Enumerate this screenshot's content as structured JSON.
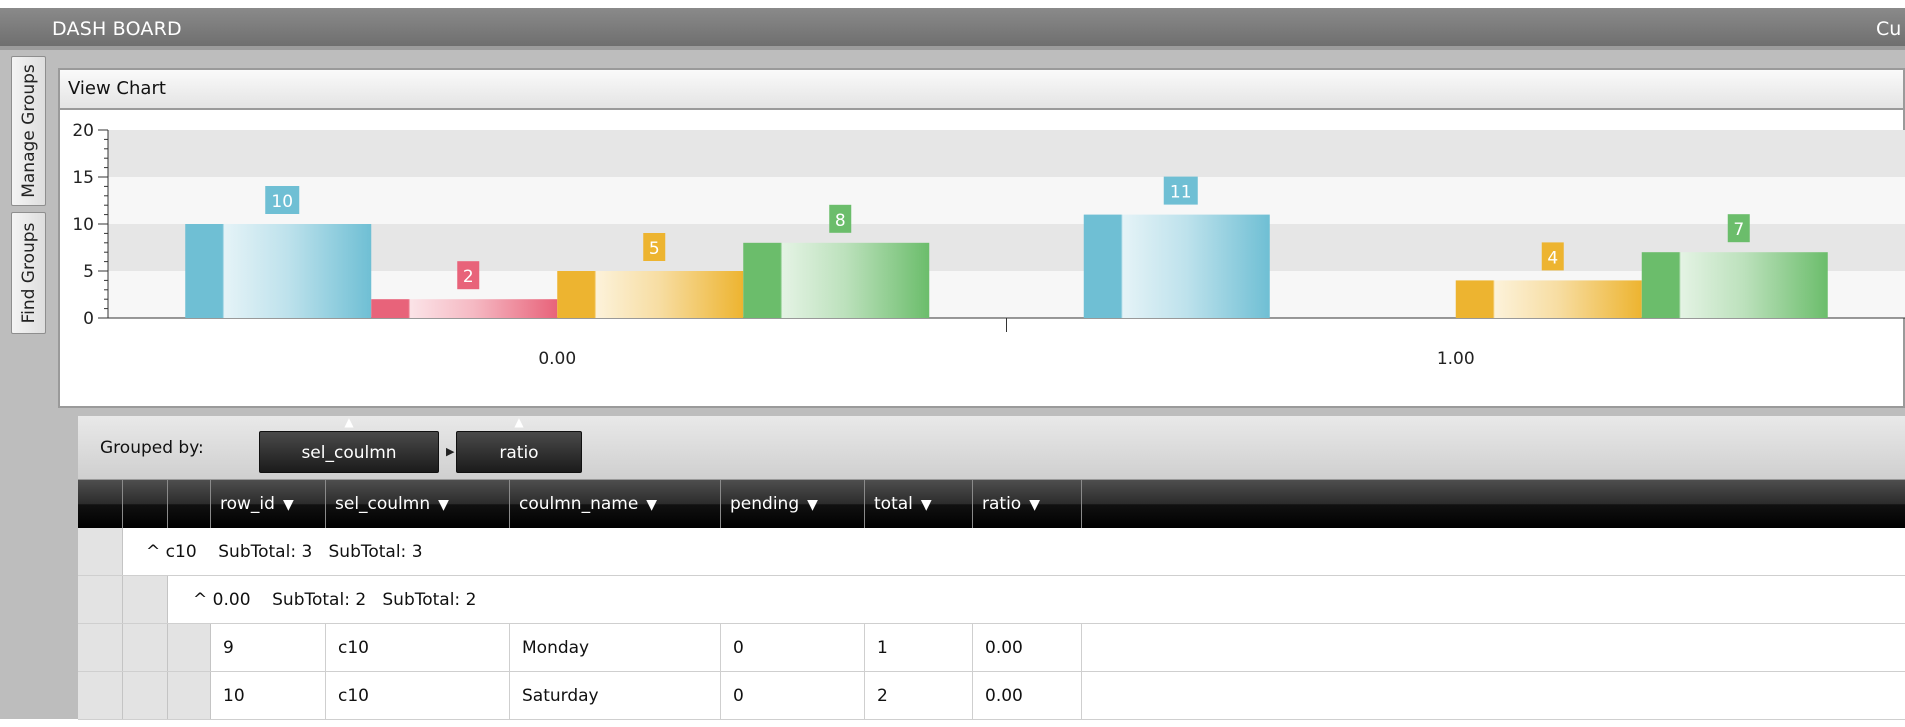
{
  "header": {
    "title": "DASH BOARD",
    "right_text": "Cu"
  },
  "side_tabs": {
    "manage": "Manage Groups",
    "find": "Find Groups"
  },
  "chart_panel": {
    "title": "View Chart"
  },
  "chart_data": {
    "type": "bar",
    "categories": [
      "0.00",
      "1.00"
    ],
    "series": [
      {
        "color": "#6fbfd4",
        "values": [
          10,
          11
        ]
      },
      {
        "color": "#e8637a",
        "values": [
          2,
          null
        ]
      },
      {
        "color": "#edb430",
        "values": [
          5,
          4
        ]
      },
      {
        "color": "#6bbd6b",
        "values": [
          8,
          7
        ]
      }
    ],
    "y_ticks": [
      "0",
      "5",
      "10",
      "15",
      "20"
    ],
    "ylim": [
      0,
      20
    ],
    "grid": true,
    "data_labels": true
  },
  "grid": {
    "grouped_by_label": "Grouped by:",
    "group_chips": [
      "sel_coulmn",
      "ratio"
    ],
    "columns": [
      "row_id",
      "sel_coulmn",
      "coulmn_name",
      "pending",
      "total",
      "ratio"
    ],
    "group1": {
      "toggle": "^",
      "label": "c10",
      "subtotal1": "SubTotal: 3",
      "subtotal2": "SubTotal: 3"
    },
    "group2": {
      "toggle": "^",
      "label": "0.00",
      "subtotal1": "SubTotal: 2",
      "subtotal2": "SubTotal: 2"
    },
    "rows": [
      [
        "9",
        "c10",
        "Monday",
        "0",
        "1",
        "0.00"
      ],
      [
        "10",
        "c10",
        "Saturday",
        "0",
        "2",
        "0.00"
      ]
    ]
  }
}
